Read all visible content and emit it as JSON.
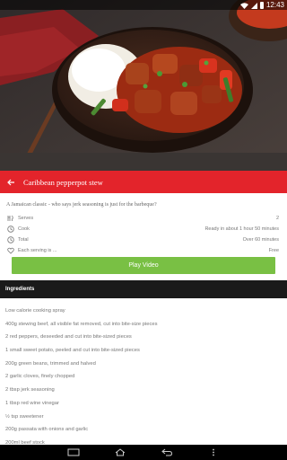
{
  "status_bar": {
    "time": "12:43",
    "icons": [
      "wifi-icon",
      "signal-icon",
      "battery-icon"
    ]
  },
  "header": {
    "back_icon": "back-arrow-icon",
    "title": "Caribbean pepperpot stew"
  },
  "recipe": {
    "description": "A Jamaican classic - who says jerk seasoning is just for the barbeque?",
    "info": [
      {
        "icon": "serves-icon",
        "label": "Serves",
        "value": "2"
      },
      {
        "icon": "clock-icon",
        "label": "Cook",
        "value": "Ready in about 1 hour 50 minutes"
      },
      {
        "icon": "clock-icon",
        "label": "Total",
        "value": "Over 60 minutes"
      },
      {
        "icon": "heart-icon",
        "label": "Each serving is ...",
        "value": "Free"
      }
    ],
    "play_label": "Play Video"
  },
  "ingredients": {
    "header": "Ingredients",
    "items": [
      "Low calorie cooking spray",
      "400g stewing beef, all visible fat removed, cut into bite-size pieces",
      "2 red peppers, deseeded and cut into bite-sized pieces",
      "1 small sweet potato, peeled and cut into bite-sized pieces",
      "200g green beans, trimmed and halved",
      "2 garlic cloves, finely chopped",
      "2 tbsp jerk seasoning",
      "1 tbsp red wine vinegar",
      "½ tsp sweetener",
      "200g passata with onions and garlic",
      "200ml beef stock"
    ]
  },
  "nav_bar": {
    "icons": [
      "back-icon",
      "home-icon",
      "recents-icon",
      "menu-icon"
    ]
  },
  "colors": {
    "accent": "#e3242b",
    "play_button": "#79c044",
    "header_dark": "#1a1a1a"
  }
}
